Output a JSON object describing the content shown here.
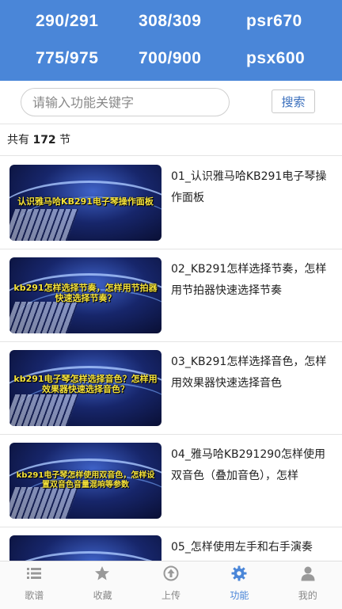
{
  "header": {
    "models": [
      "290/291",
      "308/309",
      "psr670",
      "775/975",
      "700/900",
      "psx600"
    ]
  },
  "search": {
    "placeholder": "请输入功能关键字",
    "button_label": "搜索"
  },
  "summary": {
    "prefix": "共有",
    "count": "172",
    "suffix": "节"
  },
  "lessons": [
    {
      "title": "01_认识雅马哈KB291电子琴操作面板",
      "thumb_text": "认识雅马哈KB291电子琴操作面板"
    },
    {
      "title": "02_KB291怎样选择节奏，怎样用节拍器快速选择节奏",
      "thumb_text": "kb291怎样选择节奏，怎样用节拍器快速选择节奏？"
    },
    {
      "title": "03_KB291怎样选择音色，怎样用效果器快速选择音色",
      "thumb_text": "kb291电子琴怎样选择音色？怎样用效果器快速选择音色？"
    },
    {
      "title": "04_雅马哈KB291290怎样使用双音色（叠加音色），怎样",
      "thumb_text": "kb291电子琴怎样使用双音色，怎样设置双音色音量混响等参数"
    },
    {
      "title": "05_怎样使用左手和右手演奏",
      "thumb_text": ""
    }
  ],
  "tabs": [
    {
      "label": "歌谱",
      "icon": "list-icon"
    },
    {
      "label": "收藏",
      "icon": "star-icon"
    },
    {
      "label": "上传",
      "icon": "upload-icon"
    },
    {
      "label": "功能",
      "icon": "gear-icon"
    },
    {
      "label": "我的",
      "icon": "user-icon"
    }
  ],
  "active_tab": "功能",
  "colors": {
    "header_bg": "#4a86d8",
    "accent": "#4a86d8",
    "caption_yellow": "#f5e23a"
  }
}
